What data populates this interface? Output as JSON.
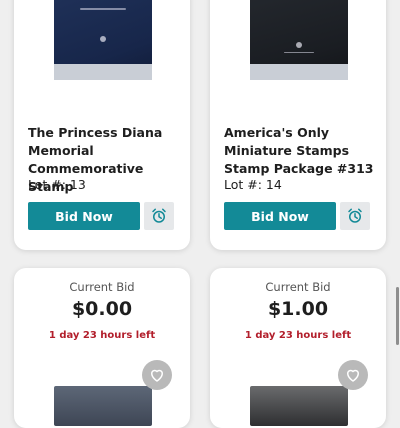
{
  "items": [
    {
      "title": "The Princess Diana Memorial Commemorative Stamp",
      "lot": "Lot #: 13",
      "bid_label": "Bid Now"
    },
    {
      "title": "America's Only Miniature Stamps Stamp Package #313",
      "lot": "Lot #: 14",
      "bid_label": "Bid Now"
    }
  ],
  "bids": [
    {
      "current_bid_label": "Current Bid",
      "amount": "$0.00",
      "time_left": "1 day 23 hours left"
    },
    {
      "current_bid_label": "Current Bid",
      "amount": "$1.00",
      "time_left": "1 day 23 hours left"
    }
  ],
  "icons": {
    "reminder": "alarm-clock-icon",
    "favorite": "heart-icon"
  },
  "colors": {
    "primary": "#138a97",
    "time_left": "#b21e2b",
    "favorite_bg": "#b9b9b9"
  }
}
